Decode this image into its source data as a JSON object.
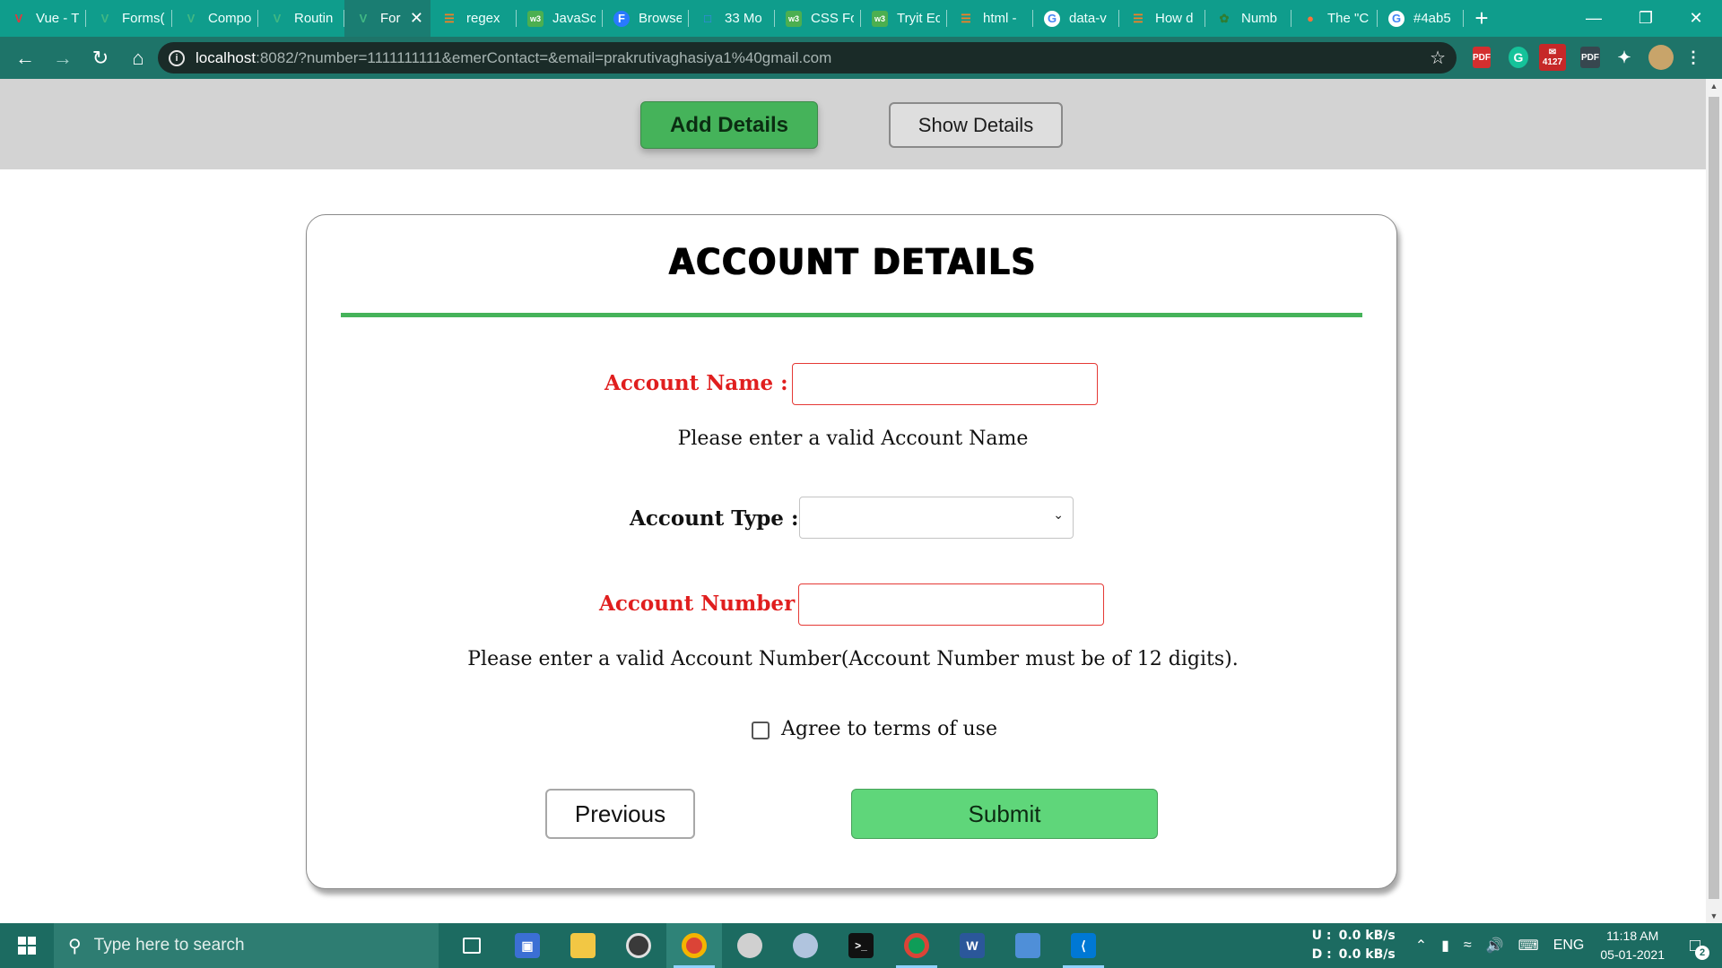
{
  "browser": {
    "tabs": [
      {
        "label": "Vue - T",
        "icon": "vue-icon",
        "icon_color": "#e0393e"
      },
      {
        "label": "Forms(",
        "icon": "vue-icon",
        "icon_color": "#41b883"
      },
      {
        "label": "Compo",
        "icon": "vue-icon",
        "icon_color": "#41b883"
      },
      {
        "label": "Routin",
        "icon": "vue-icon",
        "icon_color": "#41b883"
      },
      {
        "label": "For",
        "icon": "vue-icon",
        "icon_color": "#41b883",
        "active": true
      },
      {
        "label": "regex",
        "icon": "stackoverflow-icon",
        "icon_color": "#f48024"
      },
      {
        "label": "JavaSc",
        "icon": "w3schools-icon",
        "icon_color": "#4caf50"
      },
      {
        "label": "Browse",
        "icon": "f-icon",
        "icon_color": "#2979ff"
      },
      {
        "label": "33 Mo",
        "icon": "doc-icon",
        "icon_color": "#4285f4"
      },
      {
        "label": "CSS Fo",
        "icon": "w3schools-icon",
        "icon_color": "#4caf50"
      },
      {
        "label": "Tryit Ec",
        "icon": "w3schools-icon",
        "icon_color": "#4caf50"
      },
      {
        "label": "html -",
        "icon": "stackoverflow-icon",
        "icon_color": "#f48024"
      },
      {
        "label": "data-v",
        "icon": "google-icon",
        "icon_color": "#ffffff"
      },
      {
        "label": "How d",
        "icon": "stackoverflow-icon",
        "icon_color": "#f48024"
      },
      {
        "label": "Numb",
        "icon": "leaf-icon",
        "icon_color": "#2e7d32"
      },
      {
        "label": "The \"C",
        "icon": "firefox-icon",
        "icon_color": "#ff7139"
      },
      {
        "label": "#4ab5",
        "icon": "google-icon",
        "icon_color": "#ffffff"
      }
    ],
    "url_host": "localhost",
    "url_rest": ":8082/?number=1111111111&emerContact=&email=prakrutivaghasiya1%40gmail.com",
    "ext_badge": "4127"
  },
  "nav": {
    "add_label": "Add Details",
    "show_label": "Show Details"
  },
  "form": {
    "title": "ACCOUNT DETAILS",
    "account_name_label": "Account Name :",
    "account_name_value": "",
    "account_name_error": "Please enter a valid Account Name",
    "account_type_label": "Account Type :",
    "account_type_value": "",
    "account_number_label": "Account Number",
    "account_number_value": "",
    "account_number_error": "Please enter a valid Account Number(Account Number must be of 12 digits).",
    "terms_label": "Agree to terms of use",
    "terms_checked": false,
    "prev_label": "Previous",
    "submit_label": "Submit"
  },
  "colors": {
    "accent_green": "#45b35a",
    "error_red": "#e01e1e",
    "submit_green": "#5fd67a"
  },
  "taskbar": {
    "search_placeholder": "Type here to search",
    "upload_label": "U :",
    "upload_value": "0.0 kB/s",
    "download_label": "D :",
    "download_value": "0.0 kB/s",
    "language": "ENG",
    "time": "11:18 AM",
    "date": "05-01-2021",
    "notification_count": "2"
  }
}
